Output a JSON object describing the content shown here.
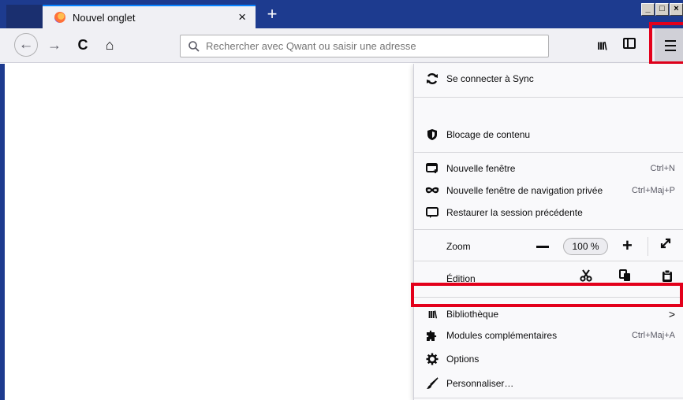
{
  "window": {
    "controls": [
      "_",
      "□",
      "×"
    ]
  },
  "tab": {
    "title": "Nouvel onglet",
    "close": "×"
  },
  "new_tab": "+",
  "nav": {
    "back": "←",
    "forward": "→",
    "reload": "C",
    "home": "⌂",
    "search_placeholder": "Rechercher avec Qwant ou saisir une adresse",
    "library": "III\\"
  },
  "menu": {
    "sync": "Se connecter à Sync",
    "content_blocking": "Blocage de contenu",
    "new_window": "Nouvelle fenêtre",
    "new_window_shortcut": "Ctrl+N",
    "private_window": "Nouvelle fenêtre de navigation privée",
    "private_window_shortcut": "Ctrl+Maj+P",
    "restore_session": "Restaurer la session précédente",
    "zoom_label": "Zoom",
    "zoom_value": "100 %",
    "zoom_plus": "+",
    "edit_label": "Édition",
    "library": "Bibliothèque",
    "library_arrow": ">",
    "addons": "Modules complémentaires",
    "addons_shortcut": "Ctrl+Maj+A",
    "options": "Options",
    "customize": "Personnaliser…"
  },
  "colors": {
    "titlebar": "#1d3b8f",
    "highlight": "#e3001b",
    "tab_accent": "#0a84ff"
  }
}
